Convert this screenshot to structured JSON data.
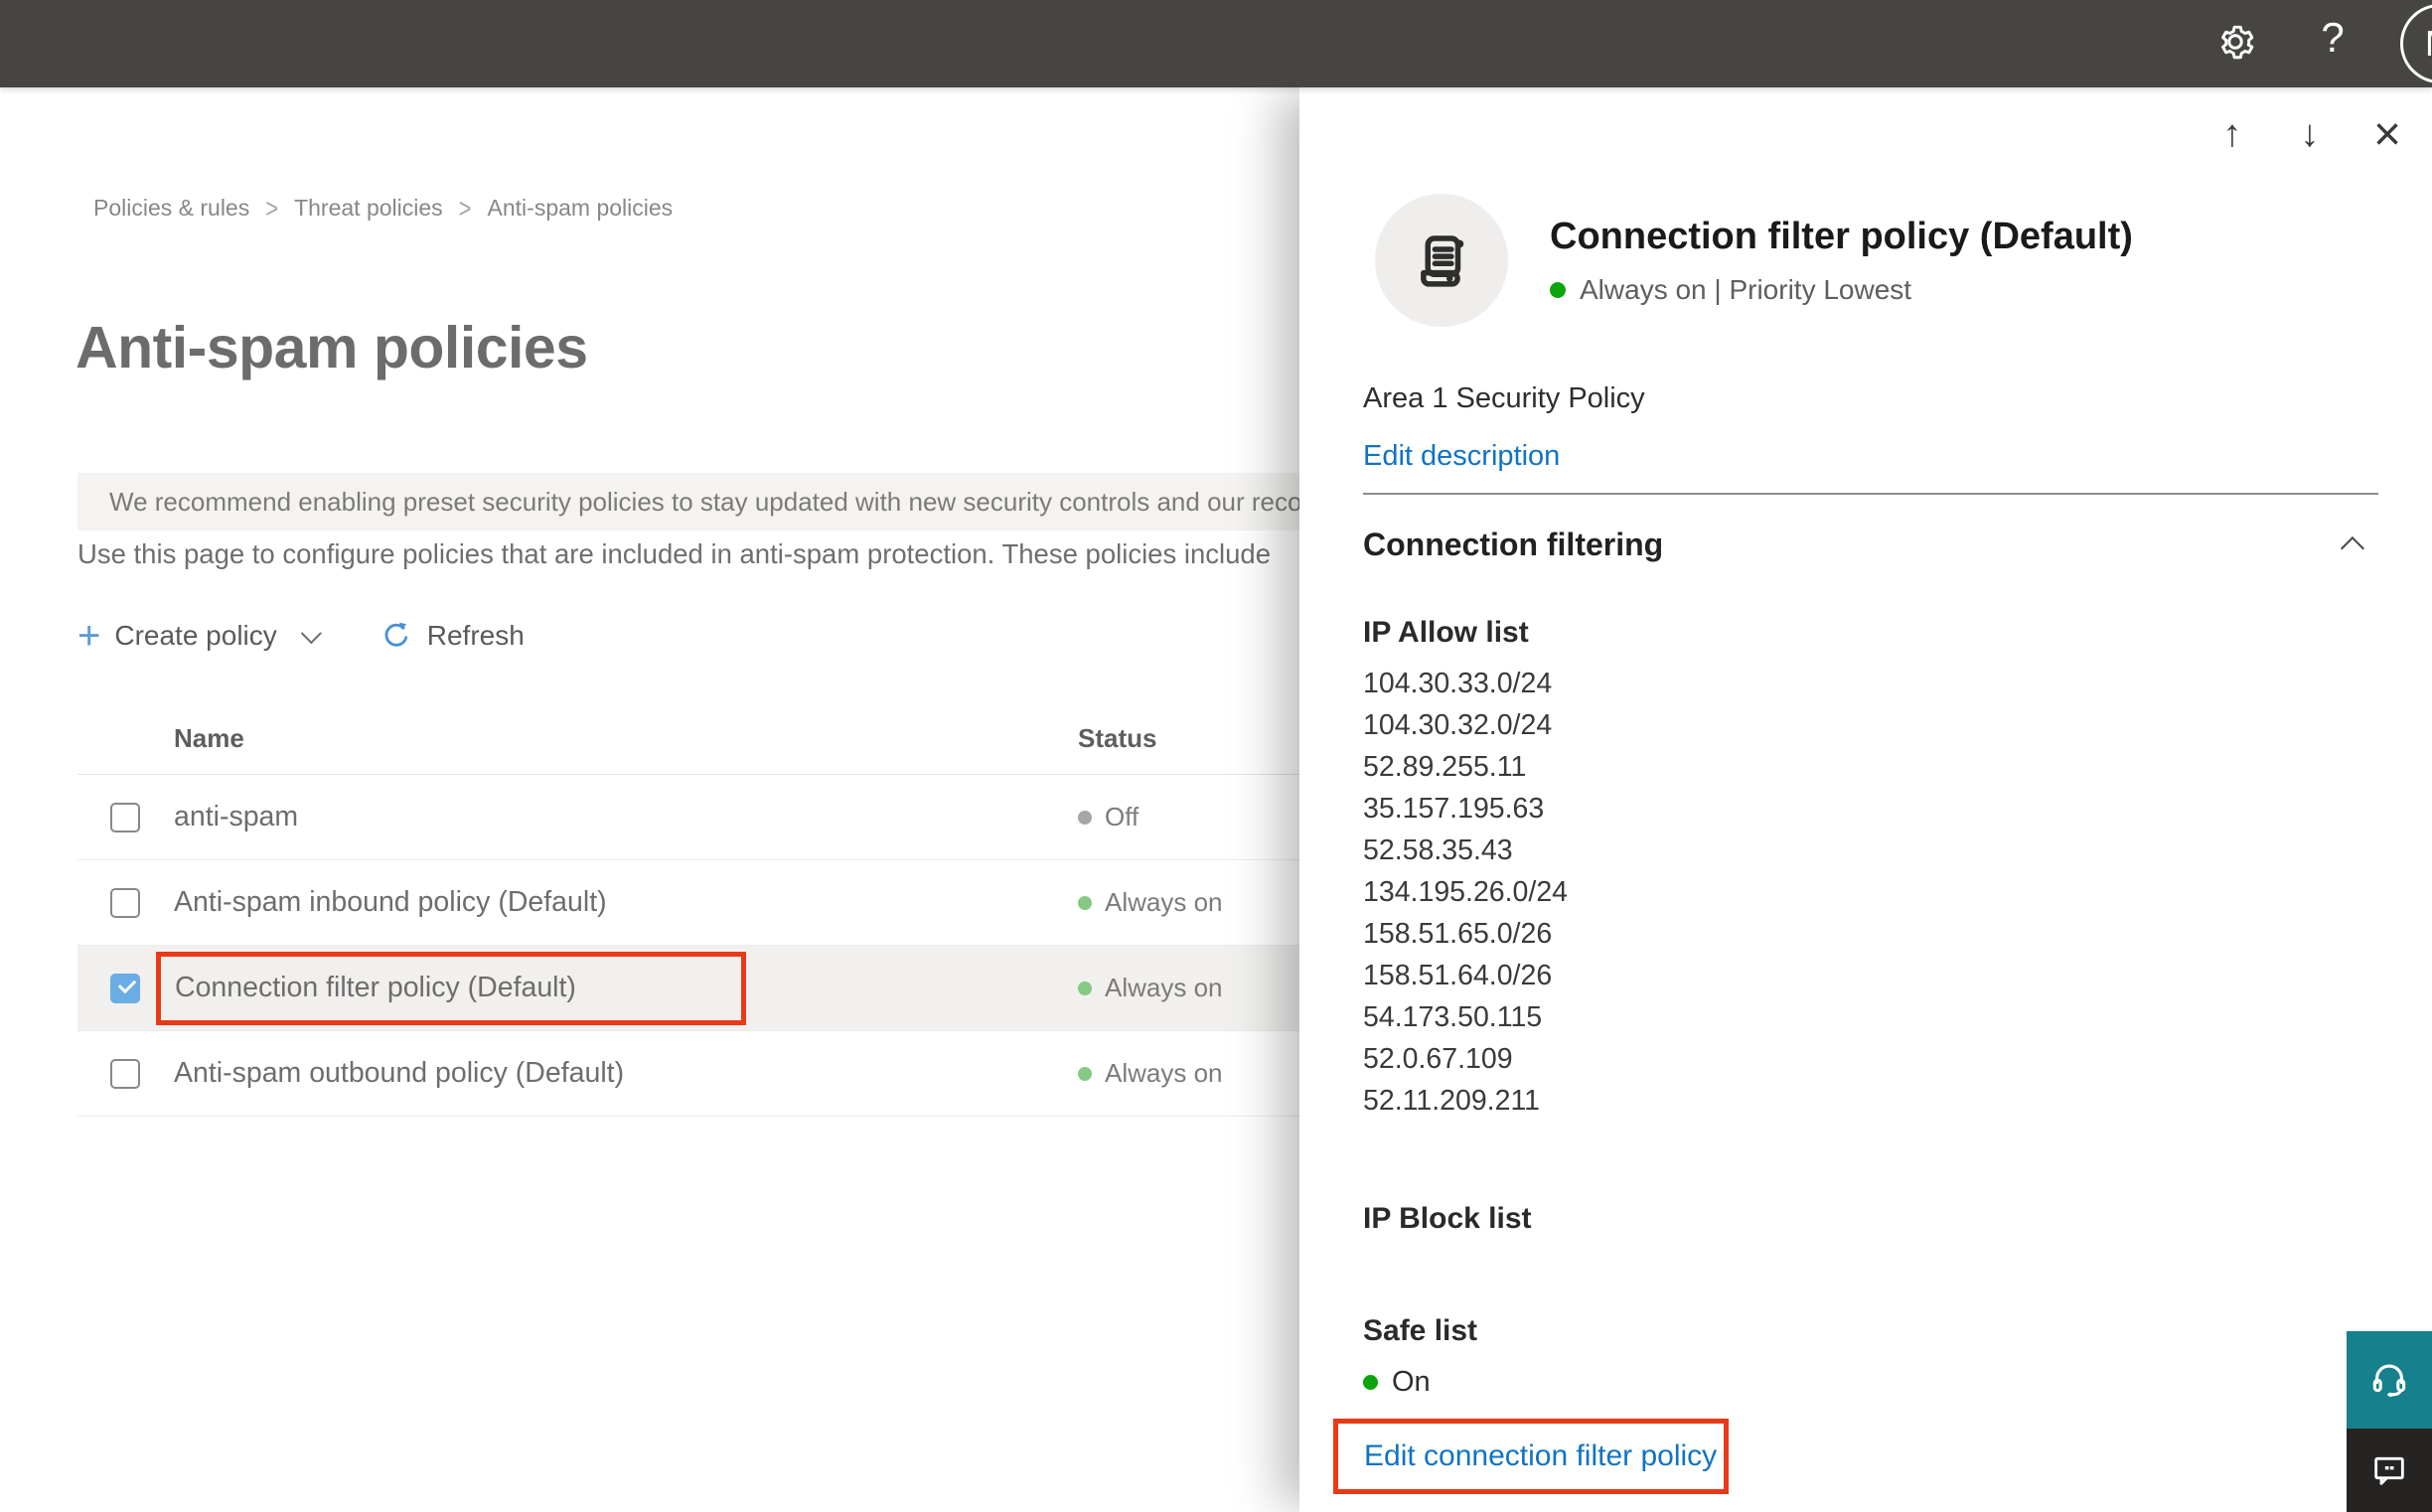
{
  "topbar": {
    "help_label": "?",
    "avatar_initial": "M"
  },
  "breadcrumb": {
    "items": [
      "Policies & rules",
      "Threat policies",
      "Anti-spam policies"
    ],
    "separator": ">"
  },
  "page": {
    "title": "Anti-spam policies",
    "banner_text": "We recommend enabling preset security policies to stay updated with new security controls and our recomme",
    "description": "Use this page to configure policies that are included in anti-spam protection. These policies include"
  },
  "toolbar": {
    "create_policy_label": "Create policy",
    "refresh_label": "Refresh"
  },
  "table": {
    "columns": {
      "name": "Name",
      "status": "Status"
    },
    "rows": [
      {
        "name": "anti-spam",
        "status": "Off"
      },
      {
        "name": "Anti-spam inbound policy (Default)",
        "status": "Always on"
      },
      {
        "name": "Connection filter policy (Default)",
        "status": "Always on"
      },
      {
        "name": "Anti-spam outbound policy (Default)",
        "status": "Always on"
      }
    ]
  },
  "panel": {
    "title": "Connection filter policy (Default)",
    "status_line": "Always on | Priority Lowest",
    "description": "Area 1 Security Policy",
    "edit_description_label": "Edit description",
    "section_title": "Connection filtering",
    "ip_allow": {
      "label": "IP Allow list",
      "items": [
        "104.30.33.0/24",
        "104.30.32.0/24",
        "52.89.255.11",
        "35.157.195.63",
        "52.58.35.43",
        "134.195.26.0/24",
        "158.51.65.0/26",
        "158.51.64.0/26",
        "54.173.50.115",
        "52.0.67.109",
        "52.11.209.211"
      ]
    },
    "ip_block_label": "IP Block list",
    "safe_list": {
      "label": "Safe list",
      "value": "On"
    },
    "edit_link_label": "Edit connection filter policy"
  },
  "colors": {
    "topbar_bg": "#474542",
    "accent_blue": "#1173c5",
    "selection_red": "#e83a17",
    "checkbox_blue": "#6aace4",
    "status_green_soft": "#85c985",
    "status_green_bright": "#0ca50c",
    "status_gray": "#a8a6a4",
    "support_teal": "#16808c",
    "feedback_dark": "#252423"
  }
}
